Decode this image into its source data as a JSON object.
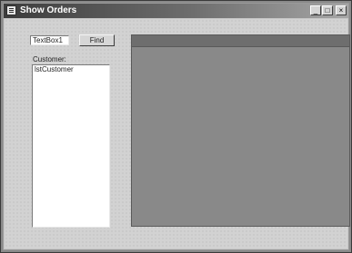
{
  "window": {
    "title": "Show Orders",
    "controls": {
      "minimize": "_",
      "maximize": "□",
      "close": "×"
    }
  },
  "form": {
    "textbox": {
      "value": "TextBox1"
    },
    "find_button": {
      "label": "Find"
    },
    "customer_label": "Customer:",
    "listbox": {
      "items": [
        "lstCustomer"
      ]
    }
  },
  "colors": {
    "grid_background": "#898989",
    "grid_caption": "#6e6e6e",
    "form_background": "#d2d2d2"
  },
  "icons": {
    "app": "form-window-icon",
    "minimize": "minimize-icon",
    "maximize": "maximize-icon",
    "close": "close-icon"
  }
}
